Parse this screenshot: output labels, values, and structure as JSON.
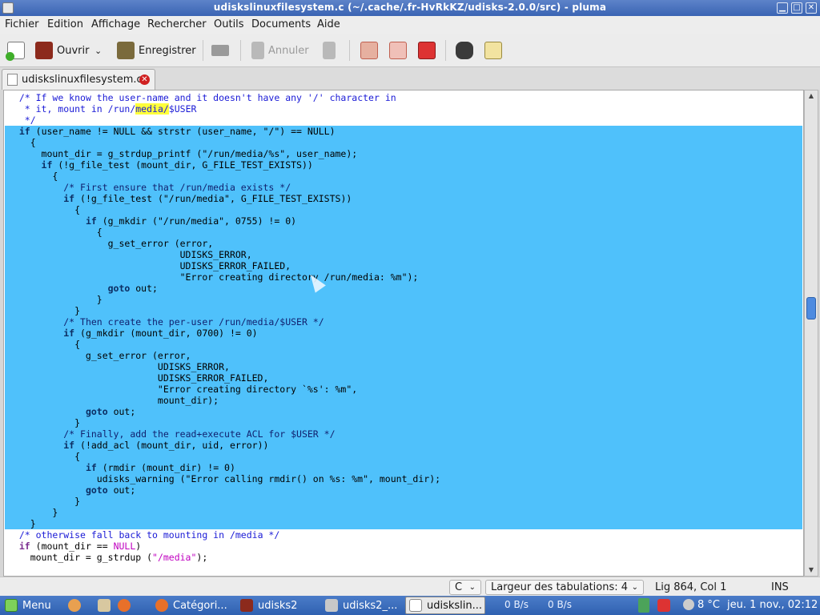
{
  "window": {
    "title": "udiskslinuxfilesystem.c (~/.cache/.fr-HvRkKZ/udisks-2.0.0/src) - pluma",
    "min": "▁",
    "max": "□",
    "close": "✕"
  },
  "menu": [
    "Fichier",
    "Edition",
    "Affichage",
    "Rechercher",
    "Outils",
    "Documents",
    "Aide"
  ],
  "toolbar": {
    "open": "Ouvrir",
    "save": "Enregistrer",
    "undo": "Annuler"
  },
  "tab": {
    "label": "udiskslinuxfilesystem.c",
    "close": "✕"
  },
  "code": [
    {
      "html": "  <span class=\"cm\">/* If we know the user-name and it doesn't have any '/' character in</span>",
      "sel": false
    },
    {
      "html": "<span class=\"cm\">   * it, mount in /run/<span class=\"hl\">media/</span>$USER</span>",
      "sel": false
    },
    {
      "html": "<span class=\"cm\">   */</span>",
      "sel": false
    },
    {
      "html": "  <span class=\"kw\">if</span> (user_name != NULL &amp;&amp; strstr (user_name, \"/\") == NULL)",
      "sel": true
    },
    {
      "html": "    {",
      "sel": true
    },
    {
      "html": "      mount_dir = g_strdup_printf (\"/run/media/%s\", user_name);",
      "sel": true
    },
    {
      "html": "      <span class=\"kw\">if</span> (!g_file_test (mount_dir, G_FILE_TEST_EXISTS))",
      "sel": true
    },
    {
      "html": "        {",
      "sel": true
    },
    {
      "html": "          <span class=\"cm\">/* First ensure that /run/media exists */</span>",
      "sel": true
    },
    {
      "html": "          <span class=\"kw\">if</span> (!g_file_test (\"/run/media\", G_FILE_TEST_EXISTS))",
      "sel": true
    },
    {
      "html": "            {",
      "sel": true
    },
    {
      "html": "              <span class=\"kw\">if</span> (g_mkdir (\"/run/media\", 0755) != 0)",
      "sel": true
    },
    {
      "html": "                {",
      "sel": true
    },
    {
      "html": "                  g_set_error (error,",
      "sel": true
    },
    {
      "html": "                               UDISKS_ERROR,",
      "sel": true
    },
    {
      "html": "                               UDISKS_ERROR_FAILED,",
      "sel": true
    },
    {
      "html": "                               \"Error creating directory /run/media: %m\");",
      "sel": true
    },
    {
      "html": "                  <span class=\"kw\">goto</span> out;",
      "sel": true
    },
    {
      "html": "                }",
      "sel": true
    },
    {
      "html": "            }",
      "sel": true
    },
    {
      "html": "          <span class=\"cm\">/* Then create the per-user /run/media/$USER */</span>",
      "sel": true
    },
    {
      "html": "          <span class=\"kw\">if</span> (g_mkdir (mount_dir, 0700) != 0)",
      "sel": true
    },
    {
      "html": "            {",
      "sel": true
    },
    {
      "html": "              g_set_error (error,",
      "sel": true
    },
    {
      "html": "                           UDISKS_ERROR,",
      "sel": true
    },
    {
      "html": "                           UDISKS_ERROR_FAILED,",
      "sel": true
    },
    {
      "html": "                           \"Error creating directory `%s': %m\",",
      "sel": true
    },
    {
      "html": "                           mount_dir);",
      "sel": true
    },
    {
      "html": "              <span class=\"kw\">goto</span> out;",
      "sel": true
    },
    {
      "html": "            }",
      "sel": true
    },
    {
      "html": "          <span class=\"cm\">/* Finally, add the read+execute ACL for $USER */</span>",
      "sel": true
    },
    {
      "html": "          <span class=\"kw\">if</span> (!add_acl (mount_dir, uid, error))",
      "sel": true
    },
    {
      "html": "            {",
      "sel": true
    },
    {
      "html": "              <span class=\"kw\">if</span> (rmdir (mount_dir) != 0)",
      "sel": true
    },
    {
      "html": "                udisks_warning (\"Error calling rmdir() on %s: %m\", mount_dir);",
      "sel": true
    },
    {
      "html": "              <span class=\"kw\">goto</span> out;",
      "sel": true
    },
    {
      "html": "            }",
      "sel": true
    },
    {
      "html": "        }",
      "sel": true
    },
    {
      "html": "    }",
      "sel": true
    },
    {
      "html": "  <span class=\"cm\">/* otherwise fall back to mounting in /media */</span>",
      "sel": false
    },
    {
      "html": "  <span class=\"kw\">if</span> (mount_dir == <span class=\"st\">NULL</span>)",
      "sel": false
    },
    {
      "html": "    mount_dir = g_strdup (<span class=\"st\">\"/media\"</span>);",
      "sel": false
    }
  ],
  "status": {
    "lang": "C",
    "tabwidth": "Largeur des tabulations: 4",
    "position": "Lig 864, Col 1",
    "mode": "INS"
  },
  "panel": {
    "menu": "Menu",
    "tasks": [
      "Catégori...",
      "udisks2",
      "udisks2_...",
      "udiskslin..."
    ],
    "net_down": "0 B/s",
    "net_up": "0 B/s",
    "weather": "8 °C",
    "clock": "jeu. 1 nov., 02:12"
  }
}
